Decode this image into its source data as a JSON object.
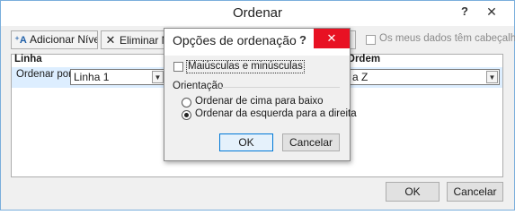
{
  "main_dialog": {
    "title": "Ordenar",
    "help_glyph": "?",
    "close_glyph": "✕",
    "toolbar": {
      "add_level_label": "Adicionar Nível",
      "delete_level_label": "Eliminar Ní"
    },
    "headers_checkbox": {
      "label": "Os meus dados têm cabeçalhos",
      "checked": false
    },
    "grid": {
      "column_headers": [
        "Linha",
        "Ordem"
      ],
      "row": {
        "label": "Ordenar por",
        "sort_field": "Linha 1",
        "order": "a Z"
      }
    },
    "ok_label": "OK",
    "cancel_label": "Cancelar"
  },
  "options_dialog": {
    "title": "Opções de ordenação",
    "help_glyph": "?",
    "close_glyph": "✕",
    "case_sensitive": {
      "label": "Maiúsculas e minúsculas",
      "checked": false
    },
    "orientation": {
      "group_label": "Orientação",
      "options": [
        {
          "label": "Ordenar de cima para baixo",
          "selected": false
        },
        {
          "label": "Ordenar da esquerda para a direita",
          "selected": true
        }
      ]
    },
    "ok_label": "OK",
    "cancel_label": "Cancelar"
  },
  "colors": {
    "close_button": "#e81123",
    "selection_row": "#ddeeff",
    "default_button_border": "#0078d7"
  }
}
